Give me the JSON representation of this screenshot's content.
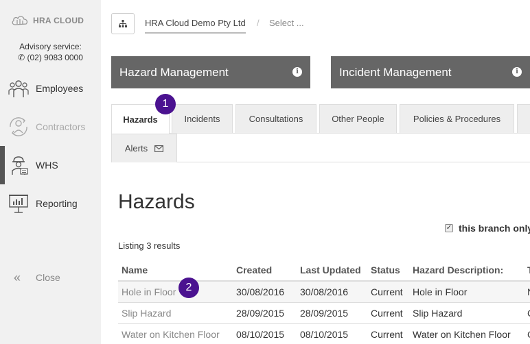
{
  "sidebar": {
    "logo_text": "HRA CLOUD",
    "advisory_label": "Advisory service:",
    "advisory_phone": "(02) 9083 0000",
    "items": [
      {
        "label": "Employees"
      },
      {
        "label": "Contractors"
      },
      {
        "label": "WHS"
      },
      {
        "label": "Reporting"
      }
    ],
    "close_label": "Close"
  },
  "topbar": {
    "company": "HRA Cloud Demo Pty Ltd",
    "separator": "/",
    "select_placeholder": "Select ..."
  },
  "modules": {
    "hazard": "Hazard Management",
    "incident": "Incident Management"
  },
  "tabs": [
    {
      "label": "Hazards"
    },
    {
      "label": "Incidents"
    },
    {
      "label": "Consultations"
    },
    {
      "label": "Other People"
    },
    {
      "label": "Policies & Procedures"
    },
    {
      "label": "Alerts"
    }
  ],
  "badges": [
    "1",
    "2"
  ],
  "main": {
    "title": "Hazards",
    "branch_only_label": "this branch only",
    "branch_only_checked": true,
    "listing_text": "Listing 3 results",
    "columns": [
      "Name",
      "Created",
      "Last Updated",
      "Status",
      "Hazard Description:"
    ],
    "rows": [
      {
        "name": "Hole in Floor",
        "created": "30/08/2016",
        "updated": "30/08/2016",
        "status": "Current",
        "description": "Hole in Floor",
        "extra": "N"
      },
      {
        "name": "Slip Hazard",
        "created": "28/09/2015",
        "updated": "28/09/2015",
        "status": "Current",
        "description": "Slip Hazard",
        "extra": "C"
      },
      {
        "name": "Water on Kitchen Floor",
        "created": "08/10/2015",
        "updated": "08/10/2015",
        "status": "Current",
        "description": "Water on Kitchen Floor",
        "extra": "C"
      }
    ]
  },
  "colors": {
    "sidebar_bg": "#f1f1f1",
    "module_bg": "#666666",
    "badge": "#4b1290"
  }
}
